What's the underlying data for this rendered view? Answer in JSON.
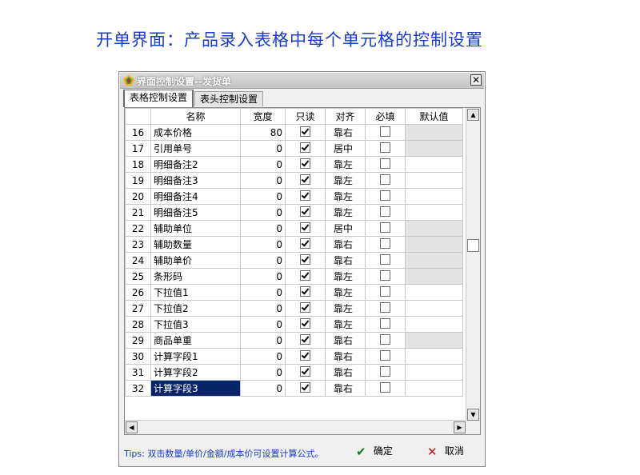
{
  "page": {
    "title": "开单界面：产品录入表格中每个单元格的控制设置"
  },
  "dialog": {
    "title": "界面控制设置--发货单",
    "close_label": "✕",
    "tabs": [
      {
        "label": "表格控制设置",
        "active": true
      },
      {
        "label": "表头控制设置",
        "active": false
      }
    ],
    "columns": [
      "",
      "名称",
      "宽度",
      "只读",
      "对齐",
      "必填",
      "默认值"
    ],
    "rows": [
      {
        "no": "16",
        "name": "成本价格",
        "width": "80",
        "readonly": true,
        "align": "靠右",
        "required": false,
        "default_gray": true
      },
      {
        "no": "17",
        "name": "引用单号",
        "width": "0",
        "readonly": true,
        "align": "居中",
        "required": false,
        "default_gray": true
      },
      {
        "no": "18",
        "name": "明细备注2",
        "width": "0",
        "readonly": true,
        "align": "靠左",
        "required": false,
        "default_gray": false
      },
      {
        "no": "19",
        "name": "明细备注3",
        "width": "0",
        "readonly": true,
        "align": "靠左",
        "required": false,
        "default_gray": false
      },
      {
        "no": "20",
        "name": "明细备注4",
        "width": "0",
        "readonly": true,
        "align": "靠左",
        "required": false,
        "default_gray": false
      },
      {
        "no": "21",
        "name": "明细备注5",
        "width": "0",
        "readonly": true,
        "align": "靠左",
        "required": false,
        "default_gray": false
      },
      {
        "no": "22",
        "name": "辅助单位",
        "width": "0",
        "readonly": true,
        "align": "居中",
        "required": false,
        "default_gray": true
      },
      {
        "no": "23",
        "name": "辅助数量",
        "width": "0",
        "readonly": true,
        "align": "靠右",
        "required": false,
        "default_gray": true
      },
      {
        "no": "24",
        "name": "辅助单价",
        "width": "0",
        "readonly": true,
        "align": "靠右",
        "required": false,
        "default_gray": true
      },
      {
        "no": "25",
        "name": "条形码",
        "width": "0",
        "readonly": true,
        "align": "靠左",
        "required": false,
        "default_gray": true
      },
      {
        "no": "26",
        "name": "下拉值1",
        "width": "0",
        "readonly": true,
        "align": "靠左",
        "required": false,
        "default_gray": false
      },
      {
        "no": "27",
        "name": "下拉值2",
        "width": "0",
        "readonly": true,
        "align": "靠左",
        "required": false,
        "default_gray": false
      },
      {
        "no": "28",
        "name": "下拉值3",
        "width": "0",
        "readonly": true,
        "align": "靠左",
        "required": false,
        "default_gray": false
      },
      {
        "no": "29",
        "name": "商品单重",
        "width": "0",
        "readonly": true,
        "align": "靠右",
        "required": false,
        "default_gray": true
      },
      {
        "no": "30",
        "name": "计算字段1",
        "width": "0",
        "readonly": true,
        "align": "靠右",
        "required": false,
        "default_gray": false
      },
      {
        "no": "31",
        "name": "计算字段2",
        "width": "0",
        "readonly": true,
        "align": "靠右",
        "required": false,
        "default_gray": false
      },
      {
        "no": "32",
        "name": "计算字段3",
        "width": "0",
        "readonly": true,
        "align": "靠右",
        "required": false,
        "default_gray": false,
        "selected": true
      }
    ],
    "tips": "Tips: 双击数量/单价/金额/成本价可设置计算公式。",
    "ok_label": "确定",
    "cancel_label": "取消",
    "icons": {
      "ok": "check-icon",
      "cancel": "cross-icon",
      "app": "app-icon"
    },
    "colors": {
      "title_text": "#1a3ccc",
      "selection": "#0a246a",
      "gray_cell": "#e4e4e4"
    }
  }
}
